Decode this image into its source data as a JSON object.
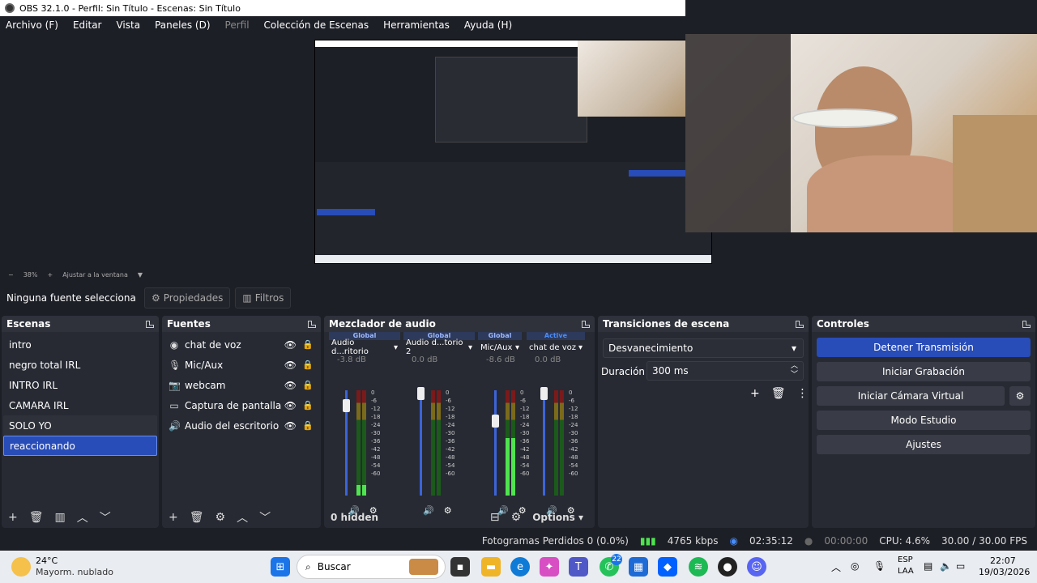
{
  "window": {
    "title": "OBS 32.1.0 - Perfil: Sin Título - Escenas: Sin Título"
  },
  "menu": [
    "Archivo (F)",
    "Editar",
    "Vista",
    "Paneles (D)",
    "Perfil",
    "Colección de Escenas",
    "Herramientas",
    "Ayuda (H)"
  ],
  "zoom": {
    "minus": "−",
    "percent": "38%",
    "plus": "+",
    "fit": "Ajustar a la ventana"
  },
  "source_bar": {
    "none_selected": "Ninguna fuente selecciona",
    "properties": "Propiedades",
    "filters": "Filtros"
  },
  "scenes": {
    "title": "Escenas",
    "items": [
      "intro",
      "negro total IRL",
      "INTRO IRL",
      "CAMARA IRL",
      "SOLO YO",
      "reaccionando"
    ],
    "selected_index": 5
  },
  "sources": {
    "title": "Fuentes",
    "items": [
      {
        "label": "chat de voz",
        "icon": "globe-icon"
      },
      {
        "label": "Mic/Aux",
        "icon": "microphone-icon"
      },
      {
        "label": "webcam",
        "icon": "camera-icon"
      },
      {
        "label": "Captura de pantalla",
        "icon": "monitor-icon"
      },
      {
        "label": "Audio del escritorio",
        "icon": "speaker-icon"
      }
    ]
  },
  "mixer": {
    "title": "Mezclador de audio",
    "channels": [
      {
        "head": "Global",
        "name": "Audio d...ritorio",
        "db": "-3.8 dB",
        "level": 0.1
      },
      {
        "head": "Global",
        "name": "Audio d...torio 2",
        "db": "0.0 dB",
        "level": 0.0
      },
      {
        "head": "Global",
        "name": "Mic/Aux",
        "db": "-8.6 dB",
        "level": 0.55
      },
      {
        "head": "Active",
        "name": "chat de voz",
        "db": "0.0 dB",
        "level": 0.0
      }
    ],
    "ticks": [
      "0",
      "-6",
      "-12",
      "-18",
      "-24",
      "-30",
      "-36",
      "-42",
      "-48",
      "-54",
      "-60"
    ],
    "hidden": "0 hidden",
    "options": "Options"
  },
  "transitions": {
    "title": "Transiciones de escena",
    "selected": "Desvanecimiento",
    "duration_label": "Duración",
    "duration_value": "300 ms"
  },
  "controls": {
    "title": "Controles",
    "buttons": [
      "Detener Transmisión",
      "Iniciar Grabación",
      "Iniciar Cámara Virtual",
      "Modo Estudio",
      "Ajustes"
    ]
  },
  "status": {
    "dropped": "Fotogramas Perdidos 0 (0.0%)",
    "bitrate": "4765 kbps",
    "stream_time": "02:35:12",
    "rec_time": "00:00:00",
    "cpu": "CPU: 4.6%",
    "fps": "30.00 / 30.00 FPS"
  },
  "taskbar": {
    "weather_temp": "24°C",
    "weather_desc": "Mayorm. nublado",
    "search": "Buscar",
    "lang1": "ESP",
    "lang2": "LAA",
    "time": "22:07",
    "date": "19/03/2026",
    "whatsapp_badge": "22"
  },
  "colors": {
    "accent": "#284cb8",
    "bg": "#1d1f26",
    "dock": "#272a33",
    "meter_green": "#4fe34f"
  }
}
